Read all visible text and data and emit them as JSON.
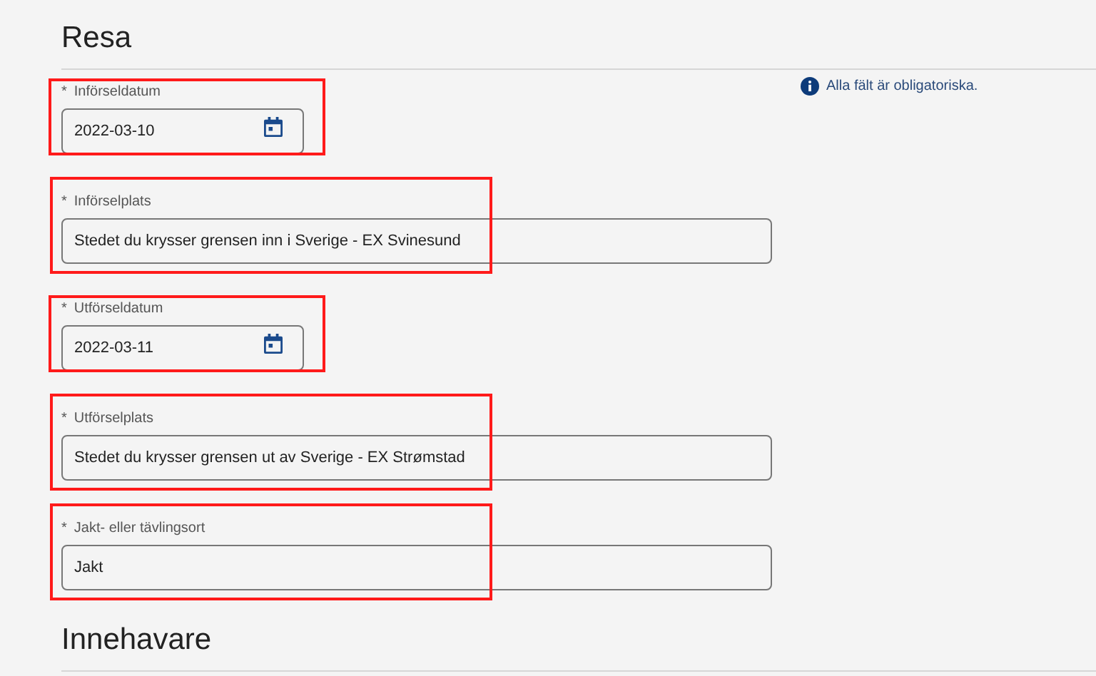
{
  "sections": [
    {
      "title": "Resa",
      "note": "Alla fält är obligatoriska.",
      "fields": [
        {
          "kind": "date",
          "marker": "*",
          "label": "Införseldatum",
          "value": "2022-03-10",
          "highlighted": true
        },
        {
          "kind": "text",
          "marker": "*",
          "label": "Införselplats",
          "value": "Stedet du krysser grensen inn i Sverige -  EX Svinesund",
          "highlighted": true
        },
        {
          "kind": "date",
          "marker": "*",
          "label": "Utförseldatum",
          "value": "2022-03-11",
          "highlighted": true
        },
        {
          "kind": "text",
          "marker": "*",
          "label": "Utförselplats",
          "value": "Stedet du krysser grensen ut av Sverige -  EX Strømstad",
          "highlighted": true
        },
        {
          "kind": "text",
          "marker": "*",
          "label": "Jakt- eller tävlingsort",
          "value": "Jakt",
          "highlighted": true
        }
      ]
    },
    {
      "title": "Innehavare"
    }
  ]
}
